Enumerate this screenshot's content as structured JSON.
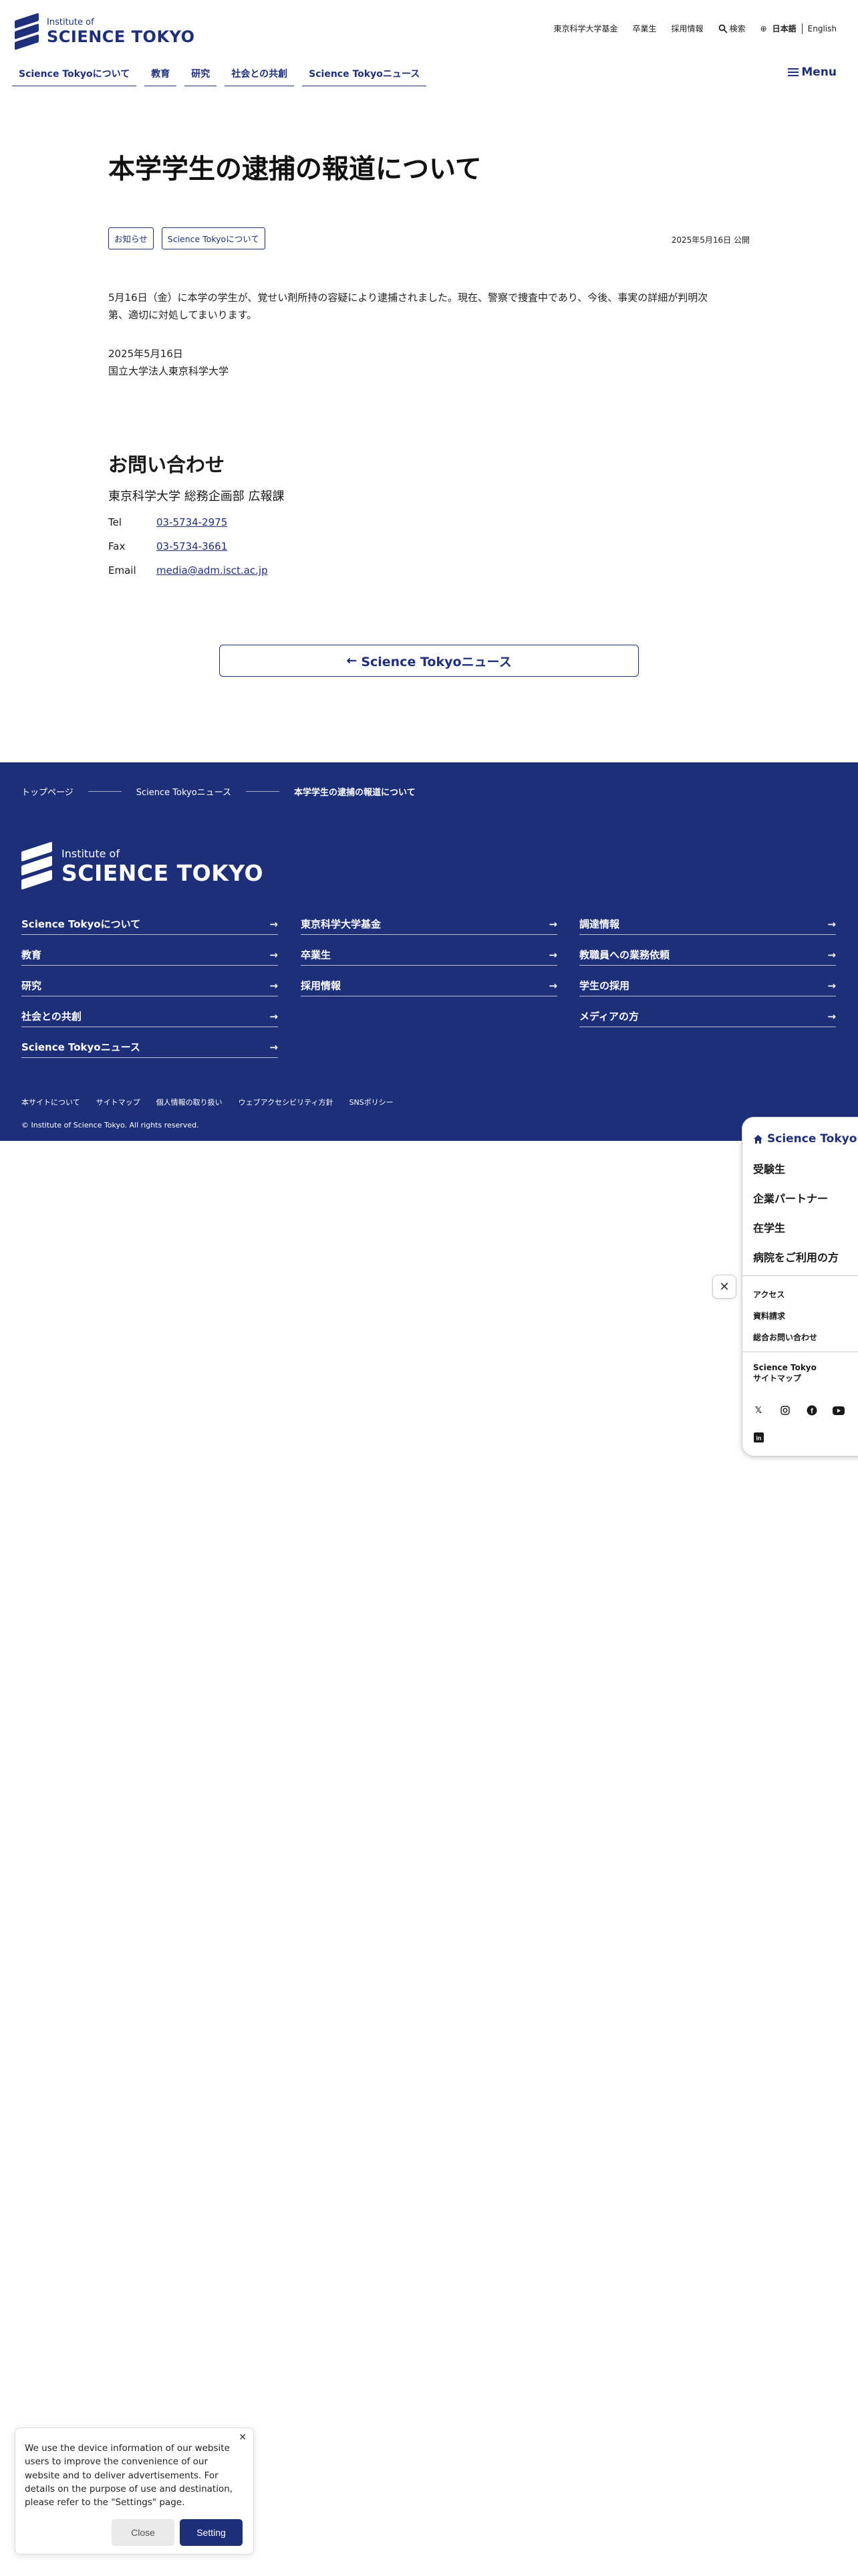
{
  "header": {
    "logo_small": "Institute of",
    "logo_big": "SCIENCE TOKYO",
    "util_links": [
      "東京科学大学基金",
      "卒業生",
      "採用情報"
    ],
    "search_label": "検索",
    "lang_current": "日本語",
    "lang_other": "English",
    "nav": [
      "Science Tokyoについて",
      "教育",
      "研究",
      "社会との共創",
      "Science Tokyoニュース"
    ],
    "menu_label": "Menu"
  },
  "article": {
    "title": "本学学生の逮捕の報道について",
    "tags": [
      "お知らせ",
      "Science Tokyoについて"
    ],
    "published": "2025年5月16日 公開",
    "body_line1": "5月16日（金）に本学の学生が、覚せい剤所持の容疑により逮捕されました。現在、警察で捜査中であり、今後、事実の詳細が判明次",
    "body_line2": "第、適切に対処してまいります。",
    "sign_date": "2025年5月16日",
    "sign_org": "国立大学法人東京科学大学"
  },
  "contact": {
    "heading": "お問い合わせ",
    "dept": "東京科学大学 総務企画部 広報課",
    "tel_label": "Tel",
    "tel": "03-5734-2975",
    "fax_label": "Fax",
    "fax": "03-5734-3661",
    "email_label": "Email",
    "email": "media@adm.isct.ac.jp"
  },
  "back_button": "Science Tokyoニュース",
  "footer": {
    "breadcrumb": [
      "トップページ",
      "Science Tokyoニュース",
      "本学学生の逮捕の報道について"
    ],
    "logo_small": "Institute of",
    "logo_big": "SCIENCE TOKYO",
    "col1": [
      "Science Tokyoについて",
      "教育",
      "研究",
      "社会との共創",
      "Science Tokyoニュース"
    ],
    "col2": [
      "東京科学大学基金",
      "卒業生",
      "採用情報"
    ],
    "col3": [
      "調達情報",
      "教職員への業務依頼",
      "学生の採用",
      "メディアの方"
    ],
    "sub_links": [
      "本サイトについて",
      "サイトマップ",
      "個人情報の取り扱い",
      "ウェブアクセシビリティ方針",
      "SNSポリシー"
    ],
    "copyright": "© Institute of Science Tokyo. All rights reserved."
  },
  "side_panel": {
    "home": "Science Tokyo",
    "main_items": [
      "受験生",
      "企業パートナー",
      "在学生",
      "病院をご利用の方"
    ],
    "sub_items": [
      "アクセス",
      "資料請求",
      "総合お問い合わせ"
    ],
    "sitemap_line1": "Science Tokyo",
    "sitemap_line2": "サイトマップ",
    "social": [
      "x-icon",
      "instagram-icon",
      "facebook-icon",
      "youtube-icon",
      "linkedin-icon"
    ]
  },
  "cookie": {
    "message": "We use the device information of our website users to improve the convenience of our website and to deliver advertisements. For details on the purpose of use and destination, please refer to the \"Settings\" page.",
    "close_label": "Close",
    "setting_label": "Setting"
  },
  "colors": {
    "brand_navy": "#1e2f7a",
    "text": "#1a1a1a"
  }
}
